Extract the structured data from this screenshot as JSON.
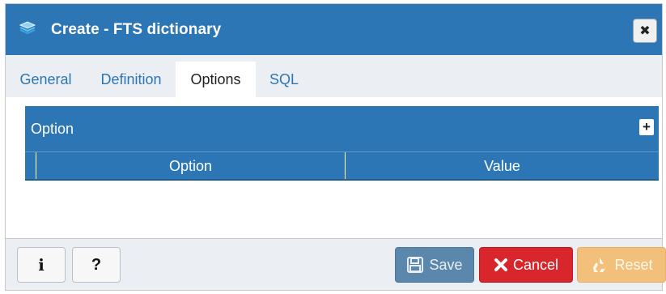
{
  "dialog": {
    "title": "Create - FTS dictionary",
    "title_icon": "fts-dictionary-icon",
    "close_icon": "close-icon",
    "close_glyph": "✖"
  },
  "tabs": [
    {
      "label": "General",
      "active": false
    },
    {
      "label": "Definition",
      "active": false
    },
    {
      "label": "Options",
      "active": true
    },
    {
      "label": "SQL",
      "active": false
    }
  ],
  "options_panel": {
    "title": "Option",
    "add_glyph": "+",
    "add_icon": "add-icon",
    "columns": [
      "Option",
      "Value"
    ],
    "rows": []
  },
  "footer": {
    "info_label": "i",
    "help_label": "?",
    "save_label": "Save",
    "cancel_label": "Cancel",
    "reset_label": "Reset"
  },
  "colors": {
    "primary": "#2c76b6",
    "save": "#5b87ad",
    "cancel": "#d9262c",
    "reset": "#f2c07a"
  }
}
